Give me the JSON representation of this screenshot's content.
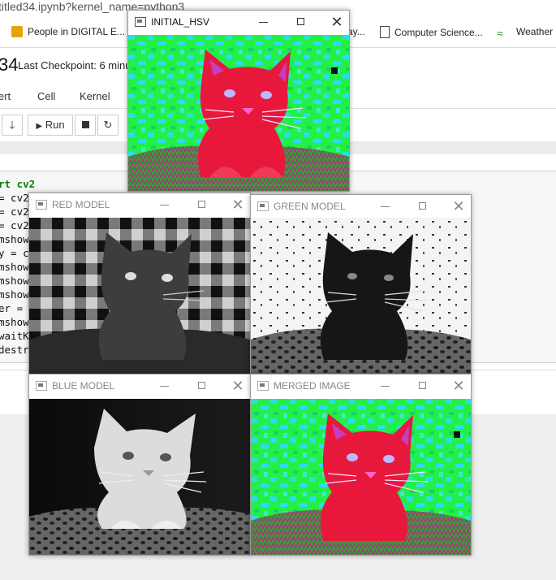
{
  "browser": {
    "url": "titled34.ipynb?kernel_name=python3",
    "bookmarks": [
      {
        "label": "People in DIGITAL E..."
      },
      {
        "label": "ay..."
      },
      {
        "label": "Computer Science..."
      },
      {
        "label": "Weather a"
      }
    ]
  },
  "notebook": {
    "name_fragment": "34",
    "checkpoint": "Last Checkpoint: 6 minu",
    "menu": [
      "ert",
      "Cell",
      "Kernel"
    ],
    "toolbar": {
      "run_label": "Run"
    },
    "code_lines": [
      "rt cv2",
      "= cv2",
      "= cv2",
      "= cv2",
      "mshow",
      "y = c",
      "mshow",
      "mshow",
      "mshow",
      "er =",
      "mshow",
      "waitK",
      "destro"
    ]
  },
  "windows": [
    {
      "title": "INITIAL_HSV",
      "active": true,
      "image": "kitten-hsv"
    },
    {
      "title": "RED MODEL",
      "active": false,
      "image": "kitten-red-channel"
    },
    {
      "title": "GREEN MODEL",
      "active": false,
      "image": "kitten-green-channel"
    },
    {
      "title": "BLUE MODEL",
      "active": false,
      "image": "kitten-blue-channel"
    },
    {
      "title": "MERGED IMAGE",
      "active": false,
      "image": "kitten-merged"
    }
  ],
  "colors": {
    "hsv_background": "#22ff44",
    "hsv_cyan": "#22e8e8",
    "hsv_cat": "#e8183c"
  }
}
